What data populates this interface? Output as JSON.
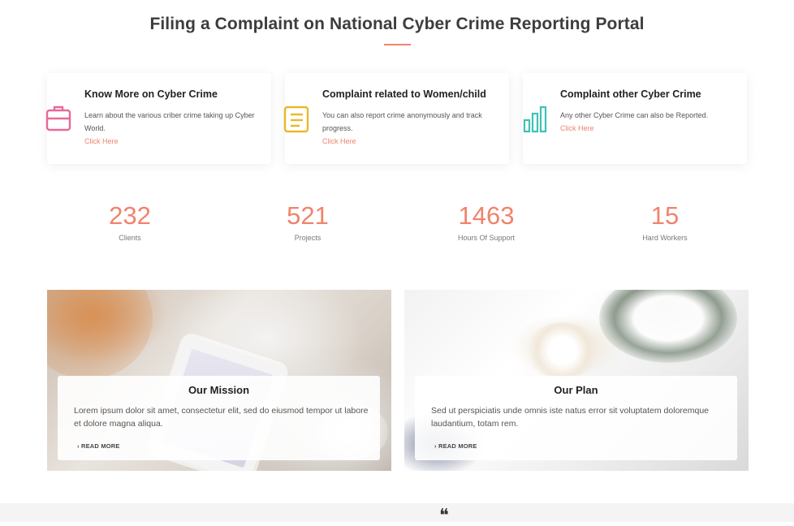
{
  "section": {
    "title": "Filing a Complaint on National Cyber Crime Reporting Portal",
    "accent_color": "#f0836c"
  },
  "cards": [
    {
      "title": "Know More on Cyber Crime",
      "description": "Learn about the various criber crime taking up Cyber World.",
      "link": "Click Here",
      "icon": "briefcase-icon",
      "icon_color": "#e8699a"
    },
    {
      "title": "Complaint related to Women/child",
      "description": "You can also report crime anonymously and track progress.",
      "link": "Click Here",
      "icon": "document-icon",
      "icon_color": "#e8b92a"
    },
    {
      "title": "Complaint other Cyber Crime",
      "description": "Any other Cyber Crime can also be Reported.",
      "link": "Click Here",
      "icon": "bar-chart-icon",
      "icon_color": "#3fc1b4"
    }
  ],
  "stats": [
    {
      "value": "232",
      "label": "Clients"
    },
    {
      "value": "521",
      "label": "Projects"
    },
    {
      "value": "1463",
      "label": "Hours Of Support"
    },
    {
      "value": "15",
      "label": "Hard Workers"
    }
  ],
  "features": [
    {
      "title": "Our Mission",
      "description": "Lorem ipsum dolor sit amet, consectetur elit, sed do eiusmod tempor ut labore et dolore magna aliqua.",
      "read_more": "› READ MORE"
    },
    {
      "title": "Our Plan",
      "description": "Sed ut perspiciatis unde omnis iste natus error sit voluptatem doloremque laudantium, totam rem.",
      "read_more": "› READ MORE"
    }
  ],
  "footer": {
    "quote_glyph": "❝"
  }
}
